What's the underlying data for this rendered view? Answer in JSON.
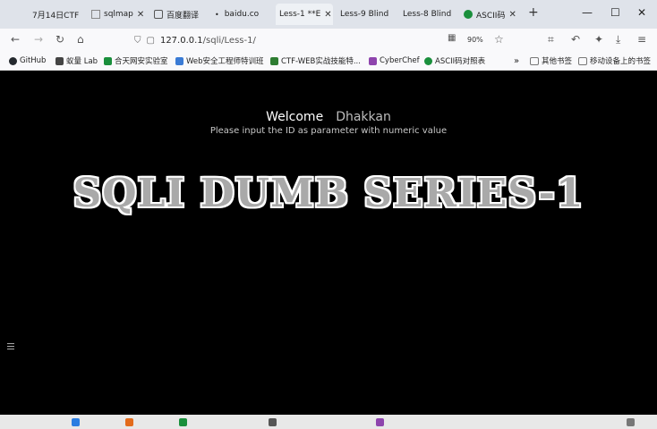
{
  "tabs": [
    {
      "label": "7月14日CTF",
      "icon": "page-icon"
    },
    {
      "label": "sqlmap",
      "icon": "sqlmap-icon"
    },
    {
      "label": "百度翻译",
      "icon": "translate-icon"
    },
    {
      "label": "baidu.co",
      "icon": "dot-icon"
    },
    {
      "label": "Less-1 **E",
      "icon": "none",
      "active": true
    },
    {
      "label": "Less-9 Blind",
      "icon": "none"
    },
    {
      "label": "Less-8 Blind",
      "icon": "none"
    },
    {
      "label": "ASCII码",
      "icon": "ascii-icon"
    }
  ],
  "toolbar": {
    "url_host": "127.0.0.1",
    "url_path": "/sqli/Less-1/",
    "zoom": "90%"
  },
  "bookmarks": [
    {
      "label": "GitHub",
      "color": "#24292e"
    },
    {
      "label": "蚁量 Lab",
      "color": "#444444"
    },
    {
      "label": "合天网安实验室",
      "color": "#1a8f3c"
    },
    {
      "label": "Web安全工程师特训班",
      "color": "#3a7bd5"
    },
    {
      "label": "CTF-WEB实战技能特...",
      "color": "#2e7d32"
    },
    {
      "label": "CyberChef",
      "color": "#8e44ad"
    },
    {
      "label": "ASCII码对照表",
      "color": "#1a8f3c"
    },
    {
      "label": "其他书签",
      "color": "#777777"
    },
    {
      "label": "移动设备上的书签",
      "color": "#777777"
    }
  ],
  "page": {
    "welcome": "Welcome",
    "name": "Dhakkan",
    "instruction": "Please input the ID as parameter with numeric value",
    "title": "SQLI DUMB SERIES-1"
  },
  "colors": {
    "page_bg": "#000000",
    "title_fill": "#a9a9a9",
    "title_outline": "#ffffff"
  }
}
